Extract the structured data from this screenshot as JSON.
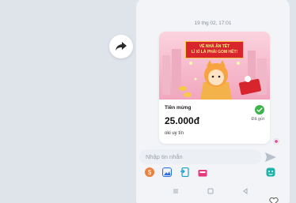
{
  "chat": {
    "timestamp": "19 thg 02, 17:01"
  },
  "gift_card": {
    "banner_line1": "VỀ NHÀ ĂN TẾT",
    "banner_line2": "LÌ XÌ LÀ PHẢI GOM HẾT!",
    "label": "Tiền mừng",
    "amount": "25.000đ",
    "message": "oki uy tín",
    "status": "Đã gửi"
  },
  "composer": {
    "placeholder": "Nhập tin nhắn"
  },
  "icons": {
    "share": "share-arrow-icon",
    "send": "send-icon",
    "status": "check-circle-icon",
    "toolbar": [
      "money-icon",
      "image-icon",
      "transfer-icon",
      "gift-box-icon",
      "sticker-icon"
    ],
    "nav": [
      "menu-icon",
      "home-icon",
      "back-icon"
    ]
  },
  "colors": {
    "accent_green": "#3cb44b",
    "banner_pink": "#f3a9c1",
    "banner_red": "#d8242c"
  }
}
